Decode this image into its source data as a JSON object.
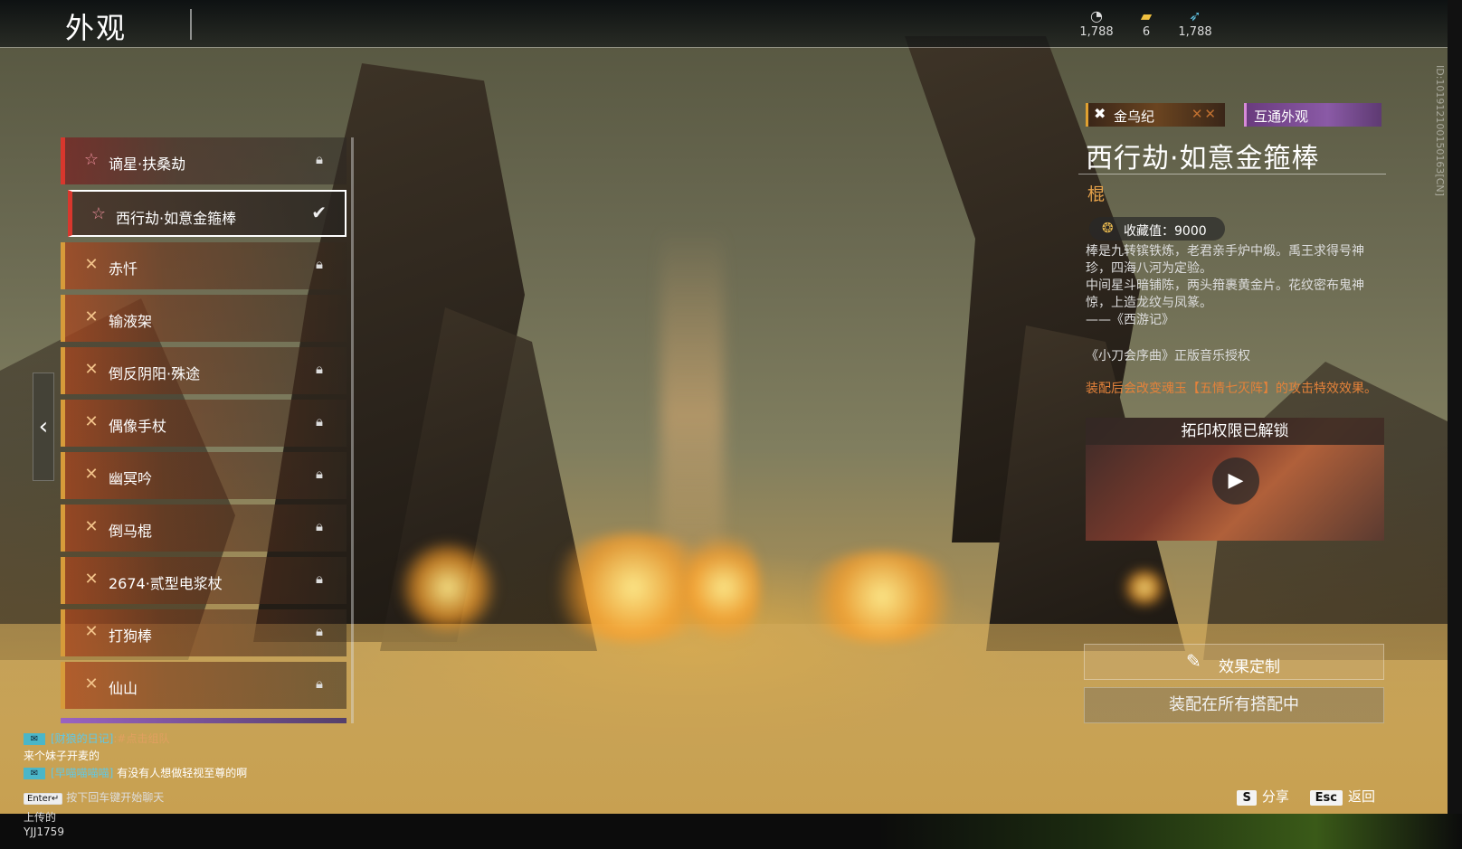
{
  "header": {
    "title": "外观",
    "currencies": [
      {
        "icon": "soul-coin-icon",
        "value": "1,788"
      },
      {
        "icon": "ticket-icon",
        "value": "6"
      },
      {
        "icon": "feather-icon",
        "value": "1,788"
      }
    ]
  },
  "list": {
    "items": [
      {
        "label": "谪星·扶桑劫",
        "icon": "star-icon",
        "state": "locked",
        "rarity": "red"
      },
      {
        "label": "西行劫·如意金箍棒",
        "icon": "star-icon",
        "state": "selected",
        "rarity": "red"
      },
      {
        "label": "赤忏",
        "icon": "cross-icon",
        "state": "locked",
        "rarity": "gold"
      },
      {
        "label": "输液架",
        "icon": "cross-icon",
        "state": "unlocked",
        "rarity": "gold"
      },
      {
        "label": "倒反阴阳·殊途",
        "icon": "cross-icon",
        "state": "locked",
        "rarity": "gold"
      },
      {
        "label": "偶像手杖",
        "icon": "cross-icon",
        "state": "locked",
        "rarity": "gold"
      },
      {
        "label": "幽冥吟",
        "icon": "cross-icon",
        "state": "locked",
        "rarity": "gold"
      },
      {
        "label": "倒马棍",
        "icon": "cross-icon",
        "state": "locked",
        "rarity": "gold"
      },
      {
        "label": "2674·贰型电浆杖",
        "icon": "cross-icon",
        "state": "locked",
        "rarity": "gold"
      },
      {
        "label": "打狗棒",
        "icon": "cross-icon",
        "state": "locked",
        "rarity": "gold"
      },
      {
        "label": "仙山",
        "icon": "cross-icon",
        "state": "locked",
        "rarity": "gold"
      }
    ]
  },
  "detail": {
    "series_tag": "金乌纪",
    "shared_tag": "互通外观",
    "name": "西行劫·如意金箍棒",
    "type": "棍",
    "collect_label": "收藏值：9000",
    "desc_lines": [
      "棒是九转镔铁炼，老君亲手炉中煅。禹王求得号神珍，四海八河为定验。",
      "中间星斗暗铺陈，两头箝裹黄金片。花纹密布鬼神惊，上造龙纹与凤篆。",
      "——《西游记》"
    ],
    "music": "《小刀会序曲》正版音乐授权",
    "effect_note": "装配后会改变魂玉【五情七灭阵】的攻击特效效果。",
    "video_title": "拓印权限已解锁",
    "btn_effect": "效果定制",
    "btn_equip": "装配在所有搭配中",
    "side_id": "ID:101912100150163[CN]"
  },
  "chat": {
    "line1_name": "[财狼的日记]",
    "line1_team": ":#点击组队",
    "line2": "来个妹子开麦的",
    "line3_name": "[早喵喵喵喵]",
    "line3_msg": " 有没有人想做轻视至尊的啊",
    "hint_key": "Enter↵",
    "hint": "按下回车键开始聊天"
  },
  "hotkeys": {
    "share_key": "S",
    "share": "分享",
    "back_key": "Esc",
    "back": "返回"
  },
  "uploader": {
    "line1": "上传的",
    "line2": "YJJ1759"
  }
}
